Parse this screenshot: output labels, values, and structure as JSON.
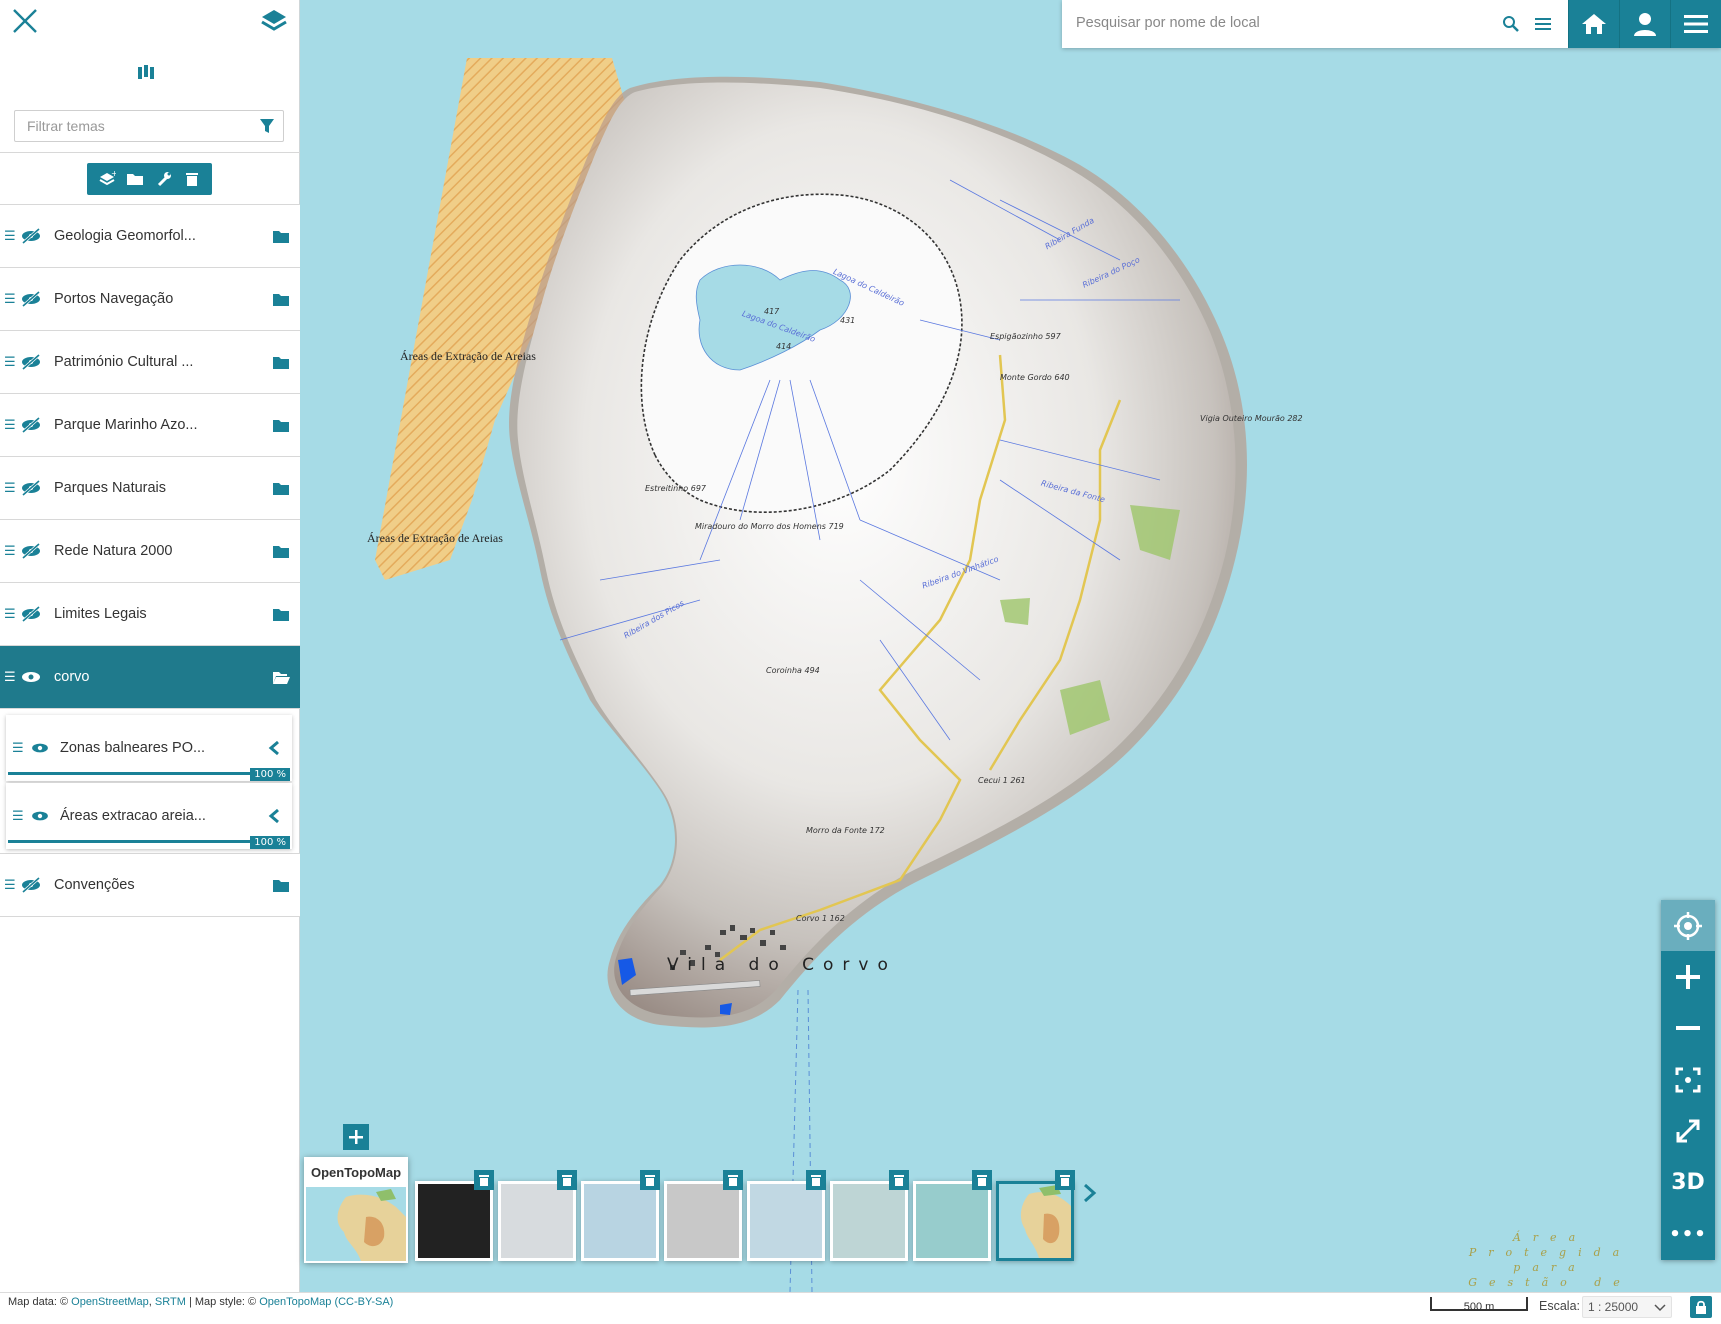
{
  "sidebar": {
    "filter_placeholder": "Filtrar temas",
    "layers": [
      {
        "label": "Geologia Geomorfol..."
      },
      {
        "label": "Portos Navegação"
      },
      {
        "label": "Património Cultural ..."
      },
      {
        "label": "Parque Marinho Azo..."
      },
      {
        "label": "Parques Naturais"
      },
      {
        "label": "Rede Natura 2000"
      },
      {
        "label": "Limites Legais"
      }
    ],
    "active_group": {
      "label": "corvo"
    },
    "sublayers": [
      {
        "label": "Zonas balneares PO...",
        "opacity": "100 %"
      },
      {
        "label": "Áreas extracao areia...",
        "opacity": "100 %"
      }
    ],
    "after_group": [
      {
        "label": "Convenções"
      }
    ]
  },
  "search": {
    "placeholder": "Pesquisar por nome de local"
  },
  "map": {
    "labels": {
      "sand_1": "Áreas de Extração de Areias",
      "sand_2": "Áreas de Extração de Areias",
      "town": "Vila do Corvo",
      "peak_1": "Espigãozinho\n597",
      "peak_2": "Monte Gordo\n640",
      "peak_3": "Estreitinho\n697",
      "peak_4": "Miradouro do Morro dos Homens\n719",
      "peak_5": "Coroinha\n494",
      "peak_6": "Morro da Fonte\n172",
      "peak_7": "Cecui 1\n261",
      "peak_8": "Vigia Outeiro Mourão\n282",
      "peak_9": "Corvo 1\n162",
      "lake_1": "Lagoa do Caldeirão",
      "lake_2": "Lagoa do Caldeirão",
      "elev_1": "417",
      "elev_2": "431",
      "elev_3": "414",
      "stream_1": "Ribeira Funda",
      "stream_2": "Ribeira do Poço",
      "stream_3": "Ribeira da Fonte",
      "stream_4": "Ribeira do Vinhático",
      "stream_5": "Ribeira dos Picos",
      "protected": "Área Protegida para Gestão de"
    }
  },
  "basemaps": {
    "current_name": "OpenTopoMap"
  },
  "footer": {
    "attr_prefix": "Map data: © ",
    "attr_osm": "OpenStreetMap",
    "attr_sep": ", ",
    "attr_srtm": "SRTM",
    "attr_style": " | Map style: © ",
    "attr_otm": "OpenTopoMap",
    "attr_license": "(CC-BY-SA)",
    "scalebar": "500 m",
    "scale_label": "Escala:",
    "scale_value": "1 : 25000"
  },
  "controls": {
    "threed": "3D",
    "more": "•••"
  },
  "colors": {
    "accent": "#1a8197",
    "sea": "#a6dbe6",
    "sand": "#f2c374"
  }
}
